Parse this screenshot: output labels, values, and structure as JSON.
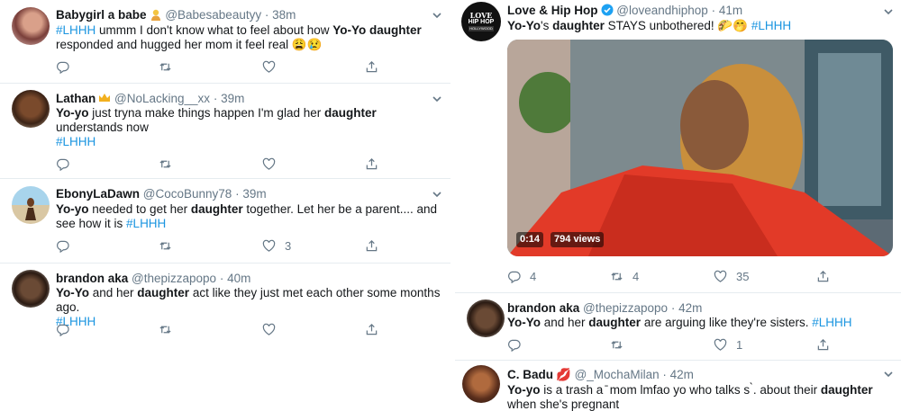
{
  "left_column": {
    "tweets": [
      {
        "name": "Babygirl a babe",
        "handle": "@Babesabeautyy",
        "time": "38m",
        "text_parts": [
          "#LHHH",
          " ummm I don't know what to feel about how ",
          "Yo-Yo daughter",
          " responded and hugged her mom it feel real ",
          "😩😢"
        ],
        "reply": "",
        "retweet": "",
        "like": ""
      },
      {
        "name": "Lathan",
        "handle": "@NoLacking__xx",
        "time": "39m",
        "text_parts": [
          "Yo-yo",
          " just tryna make things happen I'm glad her ",
          "daughter",
          " understands now",
          "#LHHH"
        ],
        "reply": "",
        "retweet": "",
        "like": ""
      },
      {
        "name": "EbonyLaDawn",
        "handle": "@CocoBunny78",
        "time": "39m",
        "text_parts": [
          "Yo-yo",
          " needed to get her ",
          "daughter",
          " together. Let her be a parent.... and see how it is ",
          "#LHHH"
        ],
        "reply": "",
        "retweet": "",
        "like": "3"
      },
      {
        "name": "brandon aka",
        "handle": "@thepizzapopo",
        "time": "40m",
        "text_parts": [
          "Yo-Yo",
          " and her ",
          "daughter",
          " act like they just met each other some months ago.",
          "#LHHH"
        ],
        "reply": "",
        "retweet": "",
        "like": ""
      }
    ]
  },
  "right_column": {
    "featured": {
      "name": "Love & Hip Hop",
      "handle": "@loveandhiphop",
      "time": "41m",
      "text_parts": [
        "Yo-Yo",
        "'s ",
        "daughter",
        " STAYS unbothered! ",
        "🌮🤭",
        " ",
        "#LHHH"
      ],
      "video_time": "0:14",
      "video_views": "794 views",
      "reply": "4",
      "retweet": "4",
      "like": "35",
      "logo_text": [
        "LOVE",
        "HIP HOP",
        "HOLLYWOOD"
      ]
    },
    "tweets": [
      {
        "name": "brandon aka",
        "handle": "@thepizzapopo",
        "time": "42m",
        "text_parts": [
          "Yo-Yo",
          " and her ",
          "daughter",
          " are arguing like they're sisters. ",
          "#LHHH"
        ],
        "reply": "",
        "retweet": "",
        "like": "1"
      },
      {
        "name": "C. Badu",
        "handle": "@_MochaMilan",
        "time": "42m",
        "emoji": "💋",
        "text_parts": [
          "Yo-yo",
          " is a trash a  ̄ mom lmfao yo who talks s  ̀. about their ",
          "daughter",
          " when she's pregnant"
        ]
      }
    ]
  },
  "colors": {
    "link": "#1b95e0",
    "muted": "#657786",
    "border": "#e6ecf0",
    "verified": "#1da1f2"
  },
  "icons": [
    "reply-icon",
    "retweet-icon",
    "like-icon",
    "share-icon",
    "chevron-down-icon",
    "verified-icon"
  ]
}
